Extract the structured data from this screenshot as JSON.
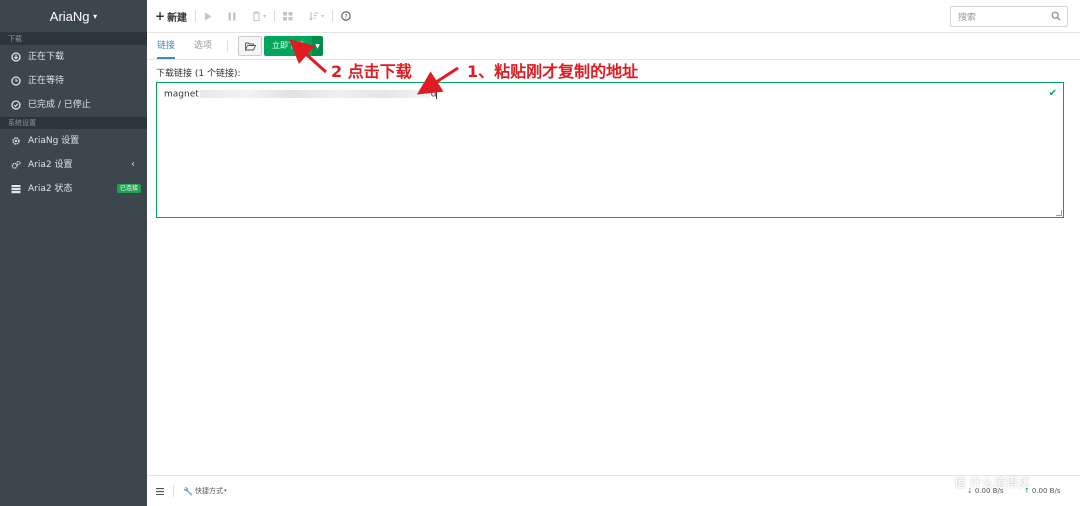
{
  "app": {
    "logo": "AriaNg"
  },
  "sidebar": {
    "sections": [
      {
        "header": "下载",
        "items": [
          {
            "label": "正在下载",
            "icon": "download-circle-icon"
          },
          {
            "label": "正在等待",
            "icon": "clock-icon"
          },
          {
            "label": "已完成 / 已停止",
            "icon": "check-circle-icon"
          }
        ]
      },
      {
        "header": "系统设置",
        "items": [
          {
            "label": "AriaNg 设置",
            "icon": "gear-icon"
          },
          {
            "label": "Aria2 设置",
            "icon": "gears-icon"
          },
          {
            "label": "Aria2 状态",
            "icon": "server-icon",
            "badge": "已连接"
          }
        ]
      }
    ]
  },
  "toolbar": {
    "new_label": "新建",
    "search_placeholder": "搜索"
  },
  "tabs": [
    {
      "label": "链接",
      "active": true
    },
    {
      "label": "选项",
      "active": false
    }
  ],
  "actions": {
    "download_now": "立即下载"
  },
  "form": {
    "links_label": "下载链接 (1 个链接):",
    "link_prefix": "magnet",
    "link_suffix": "d"
  },
  "annotations": {
    "step2": "2 点击下载",
    "step1": "1、粘贴刚才复制的地址"
  },
  "footer": {
    "shortcuts": "快捷方式",
    "download_speed": "0.00 B/s",
    "upload_speed": "0.00 B/s"
  },
  "watermark": "值 什么值得买",
  "colors": {
    "sidebar": "#3b464d",
    "accent": "#3c8dbc",
    "success": "#00a65a",
    "annotation": "#e01b23"
  }
}
